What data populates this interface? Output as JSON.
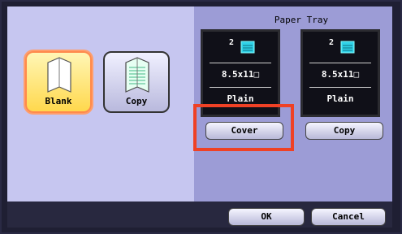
{
  "paper_source": {
    "blank_label": "Blank",
    "copy_label": "Copy"
  },
  "paper_tray": {
    "title": "Paper Tray",
    "trays": [
      {
        "number": "2",
        "size": "8.5x11□",
        "type": "Plain",
        "button_label": "Cover"
      },
      {
        "number": "2",
        "size": "8.5x11□",
        "type": "Plain",
        "button_label": "Copy"
      }
    ]
  },
  "footer": {
    "ok_label": "OK",
    "cancel_label": "Cancel"
  },
  "colors": {
    "highlight": "#ef4125",
    "selected_fill": "#ffd84d",
    "tray_icon": "#2fd2e8"
  },
  "icons": {
    "blank_page": "blank-page-icon",
    "copy_page": "copy-page-icon",
    "tray_bucket": "paper-tray-icon"
  }
}
